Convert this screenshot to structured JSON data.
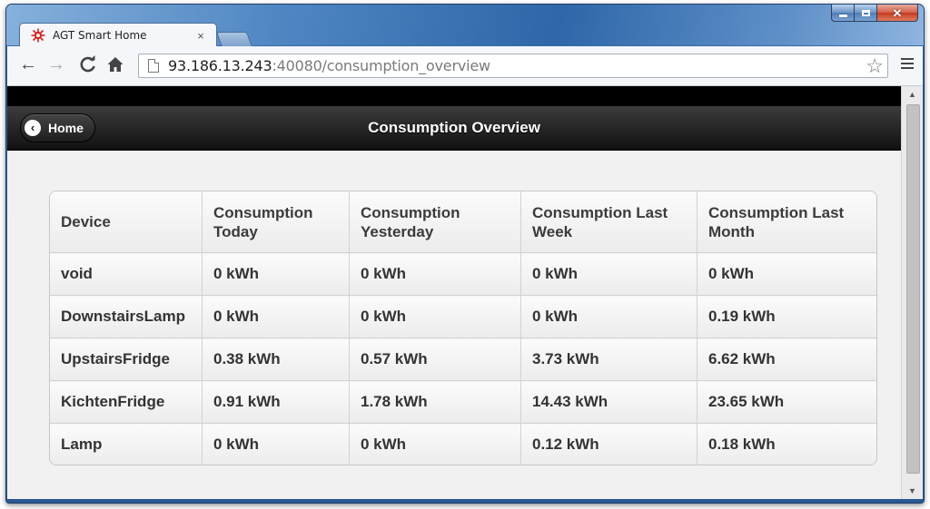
{
  "browser": {
    "tab_title": "AGT Smart Home",
    "tab_close": "×",
    "url_host": "93.186.13.243",
    "url_rest": ":40080/consumption_overview"
  },
  "page": {
    "back_label": "Home",
    "title": "Consumption Overview"
  },
  "table": {
    "headers": [
      "Device",
      "Consumption Today",
      "Consumption Yesterday",
      "Consumption Last Week",
      "Consumption Last Month"
    ],
    "rows": [
      [
        "void",
        "0 kWh",
        "0 kWh",
        "0 kWh",
        "0 kWh"
      ],
      [
        "DownstairsLamp",
        "0 kWh",
        "0 kWh",
        "0 kWh",
        "0.19 kWh"
      ],
      [
        "UpstairsFridge",
        "0.38 kWh",
        "0.57 kWh",
        "3.73 kWh",
        "6.62 kWh"
      ],
      [
        "KichtenFridge",
        "0.91 kWh",
        "1.78 kWh",
        "14.43 kWh",
        "23.65 kWh"
      ],
      [
        "Lamp",
        "0 kWh",
        "0 kWh",
        "0.12 kWh",
        "0.18 kWh"
      ]
    ]
  }
}
